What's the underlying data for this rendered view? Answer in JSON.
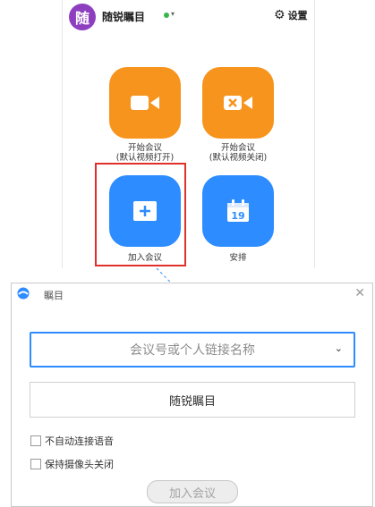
{
  "home": {
    "avatar_char": "随",
    "app_name": "随锐瞩目",
    "status_color": "#39b54a",
    "settings_label": "设置",
    "tiles": {
      "start_video_on": {
        "label_line1": "开始会议",
        "label_line2": "(默认视频打开)",
        "color": "#f7941d",
        "icon": "video-camera-icon"
      },
      "start_video_off": {
        "label_line1": "开始会议",
        "label_line2": "(默认视频关闭)",
        "color": "#f7941d",
        "icon": "video-camera-off-icon"
      },
      "join": {
        "label": "加入会议",
        "color": "#2d8cff",
        "icon": "plus-icon"
      },
      "schedule": {
        "label": "安排",
        "color": "#2d8cff",
        "icon": "calendar-icon",
        "calendar_day": "19"
      }
    },
    "highlight_color": "#e0302a"
  },
  "dialog": {
    "title": "瞩目",
    "meeting_id_placeholder": "会议号或个人链接名称",
    "display_name": "随锐瞩目",
    "options": [
      {
        "label": "不自动连接语音",
        "checked": false
      },
      {
        "label": "保持摄像头关闭",
        "checked": false
      }
    ],
    "join_button": "加入会议",
    "accent": "#2d8cff"
  }
}
